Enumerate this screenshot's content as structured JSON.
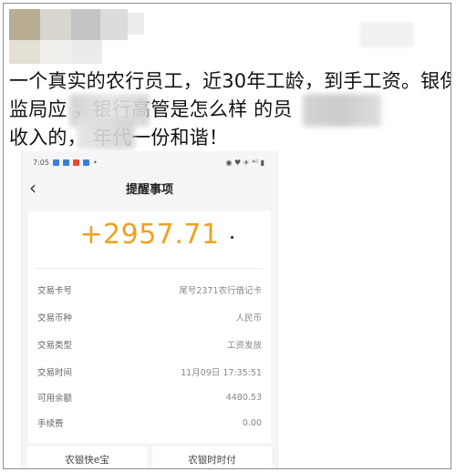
{
  "post": {
    "lines": [
      "一个真实的农行员工，近30年工龄，到手工资。银保",
      "监局应          ，银行高管是怎么样          的员",
      "收入的，          年代一份和谐！"
    ]
  },
  "phone": {
    "status_time": "7:05",
    "status_right": "◉ ♥ ✈ ⁴ᴳ ▮",
    "nav_title": "提醒事项",
    "back_icon": "‹",
    "amount": "+2957.71",
    "rows": [
      {
        "label": "交易卡号",
        "value": "尾号2371农行借记卡"
      },
      {
        "label": "交易币种",
        "value": "人民币"
      },
      {
        "label": "交易类型",
        "value": "工资发放"
      },
      {
        "label": "交易时间",
        "value": "11月09日 17:35:51"
      },
      {
        "label": "可用余额",
        "value": "4480.53"
      },
      {
        "label": "手续费",
        "value": "0.00"
      }
    ],
    "buttons": [
      "农银快e宝",
      "农银时时付"
    ]
  },
  "colors": {
    "amount": "#f0a020",
    "page_bg": "#f5f5f5"
  }
}
